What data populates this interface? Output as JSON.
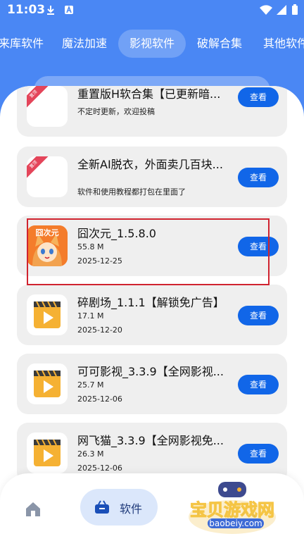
{
  "status_bar": {
    "time": "11:03"
  },
  "tabs": [
    {
      "label": "来库软件",
      "active": false
    },
    {
      "label": "魔法加速",
      "active": false
    },
    {
      "label": "影视软件",
      "active": true
    },
    {
      "label": "破解合集",
      "active": false
    },
    {
      "label": "其他软件",
      "active": false
    }
  ],
  "cards": [
    {
      "title": "重置版H软合集【已更新暗...",
      "line1": "不定时更新，欢迎投稿",
      "line2": "",
      "button": "查看",
      "thumb": "blank-with-ribbon"
    },
    {
      "title": "全新AI脱衣，外面卖几百块...",
      "line1": "软件和使用教程都打包在里面了",
      "line2": "",
      "button": "查看",
      "thumb": "blank-with-ribbon"
    },
    {
      "title": "囧次元_1.5.8.0",
      "line1": "55.8 M",
      "line2": "2025-12-25",
      "button": "查看",
      "thumb": "jiongciyuan-logo"
    },
    {
      "title": "碎剧场_1.1.1【解锁免广告】",
      "line1": "17.1 M",
      "line2": "2025-12-20",
      "button": "查看",
      "thumb": "video-play-icon"
    },
    {
      "title": "可可影视_3.3.9【全网影视...",
      "line1": "25.7 M",
      "line2": "2025-12-06",
      "button": "查看",
      "thumb": "video-play-icon"
    },
    {
      "title": "网飞猫_3.3.9【全网影视免...",
      "line1": "26.3 M",
      "line2": "2025-12-06",
      "button": "查看",
      "thumb": "video-play-icon"
    }
  ],
  "thumb_labels": {
    "logo": "囧次元",
    "ribbon": "置顶"
  },
  "bottom_nav": {
    "home_icon": "home-icon",
    "software_label": "软件",
    "software_icon": "bag-icon"
  },
  "watermark": {
    "title": "宝贝游戏网",
    "url": "baobeiy.com"
  },
  "colors": {
    "header": "#4a87f4",
    "button": "#1166e8",
    "card": "#efefef",
    "highlight": "#d0232f"
  }
}
